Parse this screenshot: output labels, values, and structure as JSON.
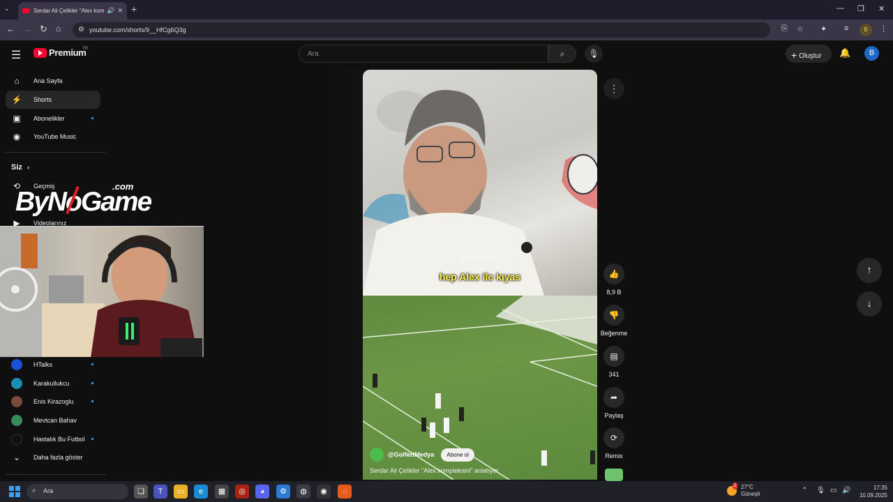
{
  "browser": {
    "tab_title": "Serdar Ali Çelikler \"Alex kom",
    "url": "youtube.com/shorts/9__HfCg6Q3g",
    "profile_initial": "B"
  },
  "header": {
    "brand": "Premium",
    "country": "TR",
    "search_placeholder": "Ara",
    "create_label": "Oluştur",
    "avatar_initial": "B"
  },
  "sidebar": {
    "main_items": [
      {
        "label": "Ana Sayfa",
        "icon": "home-icon"
      },
      {
        "label": "Shorts",
        "icon": "shorts-icon",
        "active": true
      },
      {
        "label": "Abonelikler",
        "icon": "subscriptions-icon",
        "dot": true
      },
      {
        "label": "YouTube Music",
        "icon": "youtube-music-icon"
      }
    ],
    "you_label": "Siz",
    "you_items": [
      {
        "label": "Geçmiş",
        "icon": "history-icon"
      },
      {
        "label": "Videolarınız",
        "icon": "your-videos-icon"
      }
    ],
    "channels": [
      {
        "label": "HTalks",
        "color": "#1d4fd8",
        "dot": true
      },
      {
        "label": "Karakullukcu",
        "color": "#1a8fb0",
        "dot": true
      },
      {
        "label": "Enis Kirazoglu",
        "color": "#7a4b3a",
        "dot": true
      },
      {
        "label": "Mevtcan Bahav",
        "color": "#3a8a5a"
      },
      {
        "label": "Hastalık Bu Futbol",
        "color": "#111111",
        "dot": true
      }
    ],
    "show_more": "Daha fazla göster"
  },
  "overlay": {
    "watermark_main": "ByNoGame",
    "watermark_suffix": ".com"
  },
  "short": {
    "caption": "hep Alex ile kıyas",
    "video_watermark": "@golnetmedya",
    "channel_handle": "@GolNetMedya",
    "subscribe_label": "Abone ol",
    "title": "Serdar Ali Çelikler \"Alex kompleksini\" anlatıyor"
  },
  "actions": {
    "like_count": "8,9 B",
    "dislike_label": "Beğenme",
    "comments_count": "341",
    "share_label": "Paylaş",
    "remix_label": "Remix"
  },
  "taskbar": {
    "search_placeholder": "Ara",
    "weather_temp": "27°C",
    "weather_desc": "Güneşli",
    "time": "17:35",
    "date": "10.09.2025",
    "weather_badge": "1"
  },
  "colors": {
    "accent": "#3ea6ff",
    "youtube_red": "#ff0033",
    "caption_yellow": "#fff24a"
  }
}
